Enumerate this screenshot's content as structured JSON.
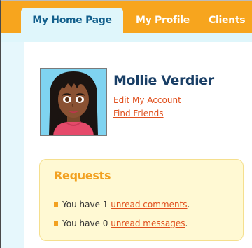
{
  "tabs": {
    "home": "My Home Page",
    "profile": "My Profile",
    "clients": "Clients"
  },
  "user": {
    "name": "Mollie Verdier",
    "edit_account": "Edit My Account",
    "find_friends": "Find Friends"
  },
  "requests": {
    "title": "Requests",
    "item1": {
      "prefix": "You have 1",
      "link": "unread comments",
      "suffix": "."
    },
    "item2": {
      "prefix": "You have 0",
      "link": "unread messages",
      "suffix": "."
    }
  },
  "colors": {
    "tab_orange": "#f7a51e",
    "tab_active_bg": "#dff6fb",
    "tab_active_text": "#125f8c",
    "link": "#e0501e",
    "requests_bg": "#fff9d3",
    "requests_title": "#f2a121",
    "name": "#1a3f66"
  },
  "icons": {
    "avatar": "cartoon-avatar-girl",
    "bullet": "square-bullet-icon"
  }
}
